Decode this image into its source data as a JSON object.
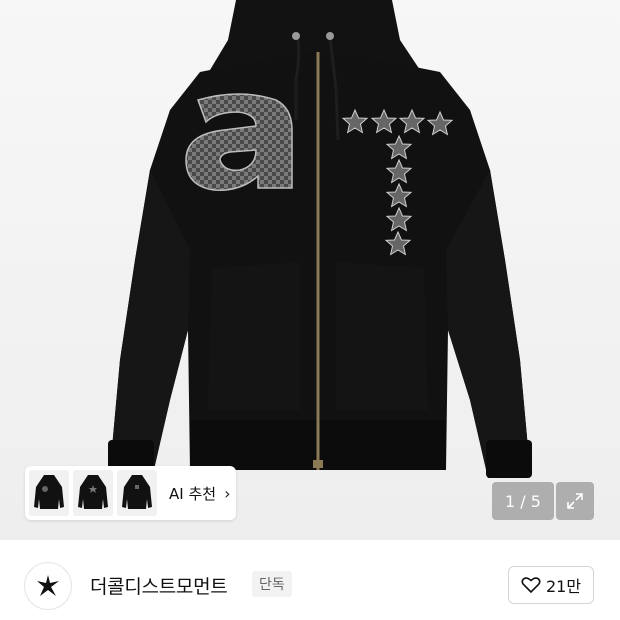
{
  "gallery": {
    "counter": "1 / 5",
    "expand_icon": "expand-icon",
    "ai_recommend_label": "AI 추천",
    "ai_chevron": "›",
    "thumbnails": [
      "hoodie-front-thumb",
      "hoodie-back-thumb",
      "hoodie-detail-thumb"
    ]
  },
  "store": {
    "name": "더콜디스트모먼트",
    "badge": "단독",
    "logo_icon": "star-burst-logo-icon",
    "likes": "21만",
    "like_icon": "heart-icon"
  },
  "colors": {
    "garment": "#111111",
    "background": "#f2f2f2",
    "print": "#5a5a5a",
    "zipper": "#8a7a55"
  }
}
